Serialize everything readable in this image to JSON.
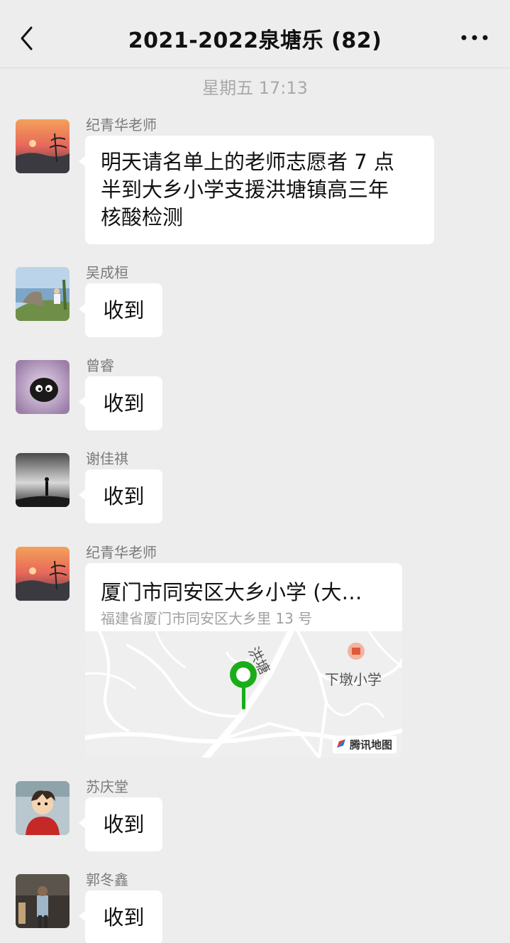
{
  "header": {
    "title": "2021-2022泉塘乐 (82)"
  },
  "timestamp": "星期五 17:13",
  "messages": [
    {
      "sender": "纪青华老师",
      "text": "明天请名单上的老师志愿者 7 点半到大乡小学支援洪塘镇高三年核酸检测"
    },
    {
      "sender": "吴成桓",
      "text": "收到"
    },
    {
      "sender": "曾睿",
      "text": "收到"
    },
    {
      "sender": "谢佳祺",
      "text": "收到"
    },
    {
      "sender": "纪青华老师",
      "location": {
        "name": "厦门市同安区大乡小学 (大…",
        "address": "福建省厦门市同安区大乡里 13 号",
        "map_labels": {
          "road": "洪塘",
          "poi": "下墩小学",
          "attribution": "腾讯地图"
        }
      }
    },
    {
      "sender": "苏庆堂",
      "text": "收到"
    },
    {
      "sender": "郭冬鑫",
      "text": "收到"
    }
  ],
  "line1": "明天请名单上的老师志愿者 7 点",
  "line2": "半到大乡小学支援洪塘镇高三年",
  "line3": "核酸检测",
  "colors": {
    "background": "#ededed",
    "bubble": "#ffffff",
    "pin": "#1aad19"
  }
}
